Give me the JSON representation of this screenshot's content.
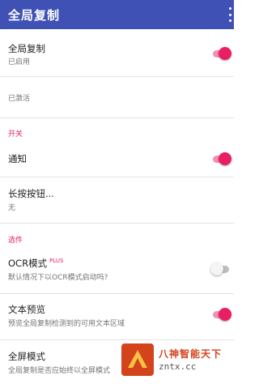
{
  "appbar": {
    "title": "全局复制",
    "menu_icon": "more-vertical-icon"
  },
  "prefs": {
    "global_copy": {
      "title": "全局复制",
      "summary": "已启用",
      "enabled": true
    },
    "status": {
      "text": "已激活"
    },
    "cat_switch": "开关",
    "notify": {
      "title": "通知",
      "enabled": true
    },
    "long_press": {
      "title": "长按按钮...",
      "summary": "无"
    },
    "cat_options": "选件",
    "ocr": {
      "title": "OCR模式",
      "badge": "PLUS",
      "summary": "默认情况下以OCR模式启动吗?",
      "enabled": false
    },
    "text_preview": {
      "title": "文本预览",
      "summary": "预览全局复制检测到的可用文本区域",
      "enabled": true
    },
    "fullscreen": {
      "title": "全屏模式",
      "summary": "全局复制是否应始终以全屏模式"
    }
  },
  "colors": {
    "primary": "#3f51b5",
    "accent": "#e91e63"
  },
  "watermark": {
    "name": "八神智能天下",
    "url": "zntx.cc"
  }
}
